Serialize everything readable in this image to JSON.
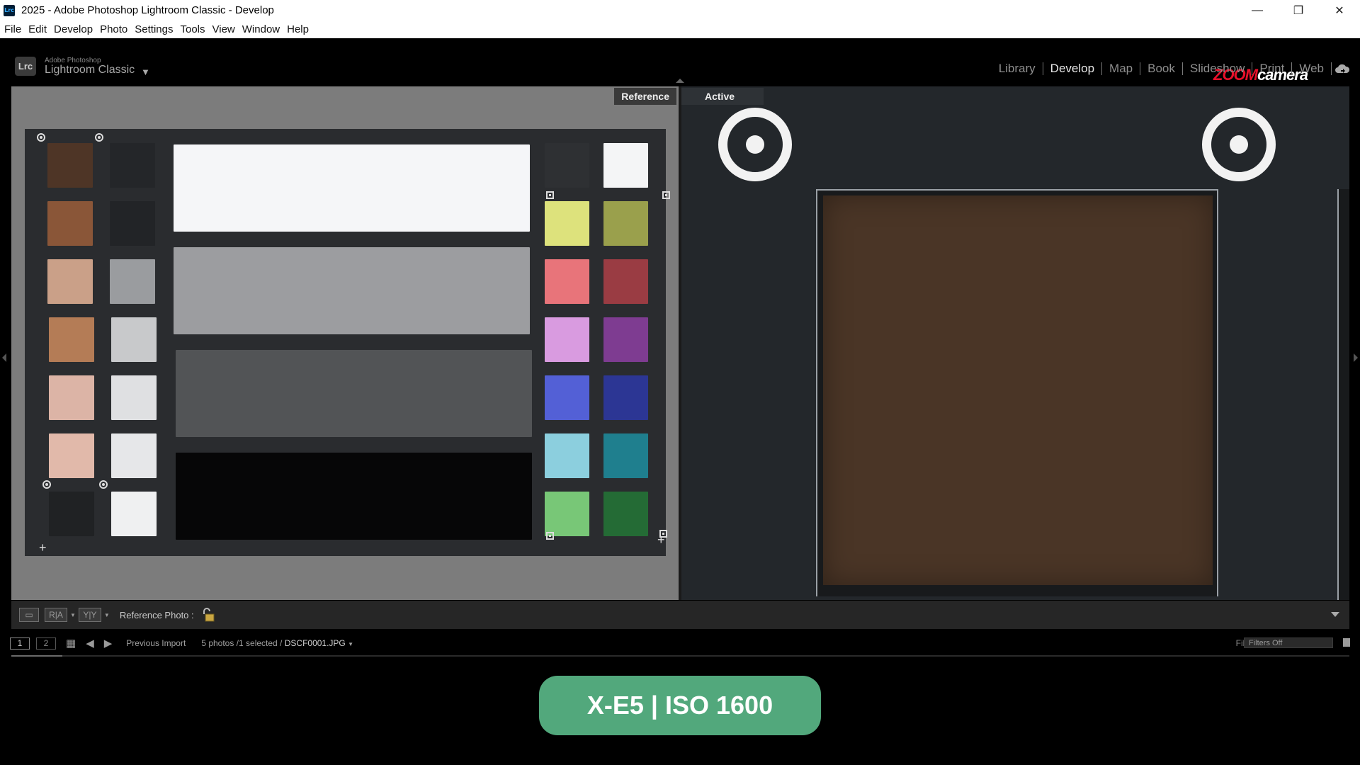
{
  "window": {
    "title": "2025 - Adobe Photoshop Lightroom Classic - Develop",
    "icon_text": "Lrc",
    "controls": {
      "minimize": "—",
      "restore": "❐",
      "close": "✕"
    }
  },
  "menu": [
    "File",
    "Edit",
    "Develop",
    "Photo",
    "Settings",
    "Tools",
    "View",
    "Window",
    "Help"
  ],
  "branding": {
    "logo_text": "Lrc",
    "small": "Adobe Photoshop",
    "big": "Lightroom Classic",
    "caret": "▼",
    "watermark_zoom": "ZOOM",
    "watermark_camera": "camera"
  },
  "modules": [
    "Library",
    "Develop",
    "Map",
    "Book",
    "Slideshow",
    "Print",
    "Web"
  ],
  "active_module": "Develop",
  "panes": {
    "reference_label": "Reference",
    "active_label": "Active"
  },
  "chart_colors": {
    "left_col1": [
      "#4e3526",
      "#8a5638",
      "#caa088",
      "#b47c56",
      "#dcb4a6",
      "#e1b9aa",
      "#202224"
    ],
    "left_col2": [
      "#242629",
      "#222427",
      "#9a9c9f",
      "#c8c9cb",
      "#dfe0e2",
      "#e6e7e9",
      "#eff0f1"
    ],
    "gray_bars": [
      "#f5f6f8",
      "#9c9da0",
      "#525456",
      "#060607"
    ],
    "right_col1": [
      "#2e3033",
      "#dde27c",
      "#e8747a",
      "#d99be0",
      "#5360d6",
      "#8ccfde",
      "#78c777"
    ],
    "right_col2": [
      "#f4f5f6",
      "#9aa04c",
      "#9a3c43",
      "#7e3c91",
      "#2c3694",
      "#1f7f8e",
      "#246b35"
    ]
  },
  "toolbar": {
    "view_loupe": "▭",
    "view_ra": "R|A",
    "view_yy": "Y|Y",
    "reference_label": "Reference Photo :"
  },
  "filmstrip": {
    "screen1": "1",
    "screen2": "2",
    "grid_icon": "▦",
    "prev_icon": "◀",
    "next_icon": "▶",
    "source": "Previous Import",
    "count": "5 photos /1 selected /",
    "filename": "DSCF0001.JPG",
    "filename_caret": "▼",
    "filter_label": "Filter :",
    "filter_value": "Filters Off"
  },
  "caption": "X-E5 | ISO 1600"
}
